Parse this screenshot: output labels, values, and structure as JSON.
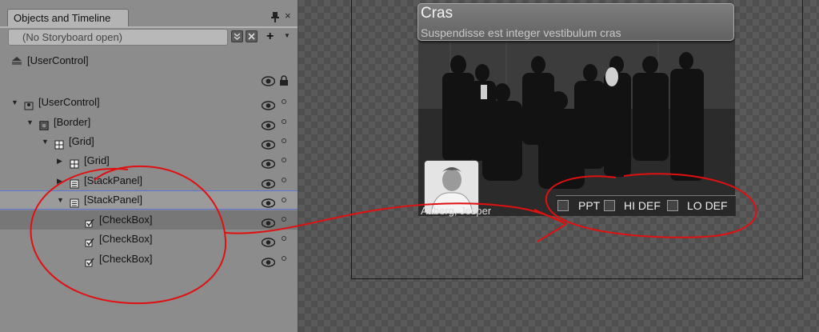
{
  "panel": {
    "tab_title": "Objects and Timeline",
    "close_glyph": "×",
    "storyboard_placeholder": "(No Storyboard open)",
    "add_glyph": "+",
    "root_label": "[UserControl]"
  },
  "tree": [
    {
      "label": "[UserControl]",
      "depth": 0,
      "expanded": true,
      "icon": "usercontrol-icon"
    },
    {
      "label": "[Border]",
      "depth": 1,
      "expanded": true,
      "icon": "border-icon"
    },
    {
      "label": "[Grid]",
      "depth": 2,
      "expanded": true,
      "icon": "grid-icon"
    },
    {
      "label": "[Grid]",
      "depth": 3,
      "expanded": false,
      "icon": "grid-icon"
    },
    {
      "label": "[StackPanel]",
      "depth": 3,
      "expanded": false,
      "icon": "stackpanel-icon"
    },
    {
      "label": "[StackPanel]",
      "depth": 3,
      "expanded": true,
      "icon": "stackpanel-icon",
      "selected": true
    },
    {
      "label": "[CheckBox]",
      "depth": 4,
      "icon": "checkbox-icon",
      "highlight": true
    },
    {
      "label": "[CheckBox]",
      "depth": 4,
      "icon": "checkbox-icon"
    },
    {
      "label": "[CheckBox]",
      "depth": 4,
      "icon": "checkbox-icon"
    }
  ],
  "card": {
    "title": "Cras",
    "subtitle": "Suspendisse est integer vestibulum cras",
    "caption": "Aaberg, Jesper"
  },
  "checkboxes": [
    "PPT",
    "HI DEF",
    "LO DEF"
  ],
  "colors": {
    "panel_bg": "#8c8c8c",
    "selection_border": "#5c75d8",
    "annotation_red": "#e01010"
  }
}
